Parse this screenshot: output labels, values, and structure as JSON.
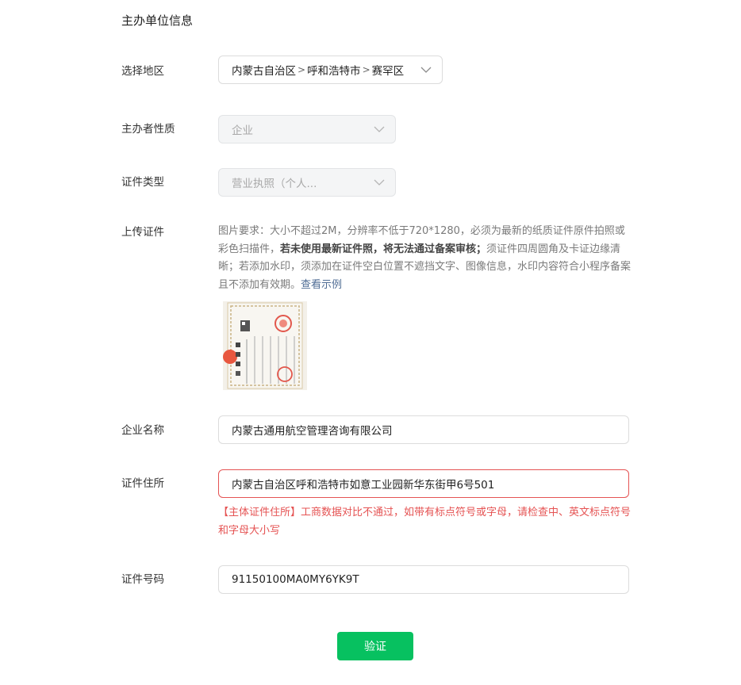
{
  "section_title": "主办单位信息",
  "labels": {
    "region": "选择地区",
    "organizer_type": "主办者性质",
    "cert_type": "证件类型",
    "upload_cert": "上传证件",
    "company_name": "企业名称",
    "cert_address": "证件住所",
    "cert_number": "证件号码"
  },
  "region": {
    "province": "内蒙古自治区",
    "city": "呼和浩特市",
    "district": "赛罕区",
    "separator": ">"
  },
  "organizer_type": {
    "value": "企业"
  },
  "cert_type": {
    "value": "营业执照（个人..."
  },
  "upload_hint": {
    "part1": "图片要求：大小不超过2M，分辨率不低于720*1280，必须为最新的纸质证件原件拍照或彩色扫描件，",
    "bold": "若未使用最新证件照，将无法通过备案审核；",
    "part2": "须证件四周圆角及卡证边缘清晰；若添加水印，须添加在证件空白位置不遮挡文字、图像信息，水印内容符合小程序备案且不添加有效期。",
    "example_link": "查看示例"
  },
  "company_name": {
    "value": "内蒙古通用航空管理咨询有限公司"
  },
  "cert_address": {
    "value": "内蒙古自治区呼和浩特市如意工业园新华东街甲6号501",
    "error": "【主体证件住所】工商数据对比不通过，如带有标点符号或字母，请检查中、英文标点符号和字母大小写"
  },
  "cert_number": {
    "value": "91150100MA0MY6YK9T"
  },
  "verify_button": "验证",
  "colors": {
    "primary_green": "#07c160",
    "error_red": "#e55353",
    "link_blue": "#4f6c94"
  },
  "icons": [
    "chevron-down-icon",
    "business-license-thumbnail"
  ]
}
